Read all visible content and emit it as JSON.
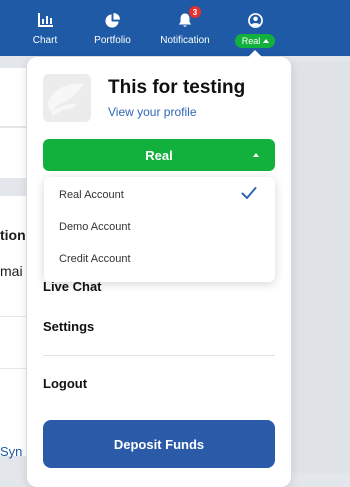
{
  "nav": {
    "chart_label": "Chart",
    "portfolio_label": "Portfolio",
    "notification_label": "Notification",
    "notification_count": "3",
    "account_pill_label": "Real"
  },
  "background": {
    "section_fragment": "tion",
    "email_fragment": "mai",
    "link_fragment": "Syn"
  },
  "profile": {
    "name": "This for testing",
    "view_profile": "View your profile"
  },
  "account_selector": {
    "selected": "Real",
    "options": [
      "Real Account",
      "Demo Account",
      "Credit Account"
    ],
    "checked_option": "Real Account"
  },
  "menu": {
    "live_chat": "Live Chat",
    "settings": "Settings",
    "logout": "Logout",
    "deposit": "Deposit Funds"
  },
  "colors": {
    "nav_bg": "#1f5aa6",
    "account_green": "#12b13d",
    "deposit_blue": "#2b5ba8",
    "badge_red": "#e5312d",
    "check_blue": "#2e66b8"
  },
  "icons": [
    "chart-icon",
    "portfolio-pie-icon",
    "bell-icon",
    "user-icon",
    "checkmark-icon",
    "avatar-placeholder-icon"
  ]
}
